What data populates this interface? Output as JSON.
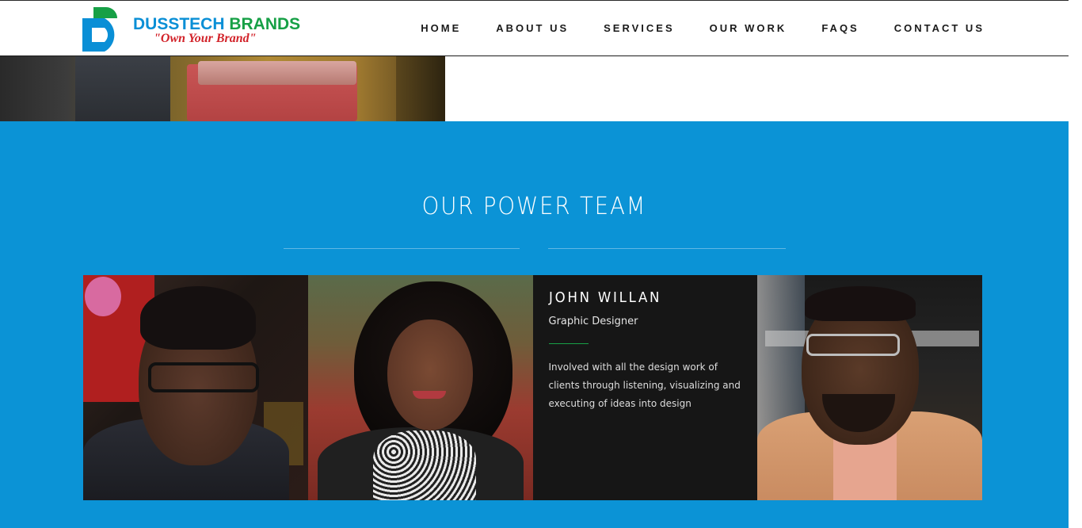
{
  "brand": {
    "name_part1": "DUSSTECH",
    "name_part2": " BRANDS",
    "tagline": "\"Own Your Brand\""
  },
  "nav": {
    "items": [
      "HOME",
      "ABOUT US",
      "SERVICES",
      "OUR WORK",
      "FAQS",
      "CONTACT US"
    ]
  },
  "team_section": {
    "title": "OUR POWER TEAM",
    "featured": {
      "name": "JOHN WILLAN",
      "role": "Graphic Designer",
      "bio": "Involved with all the design work of clients through listening, visualizing and executing of ideas into design"
    }
  },
  "colors": {
    "accent_blue": "#0b93d6",
    "brand_green": "#17a046",
    "brand_red": "#d2232a",
    "card_dark": "#161616"
  }
}
